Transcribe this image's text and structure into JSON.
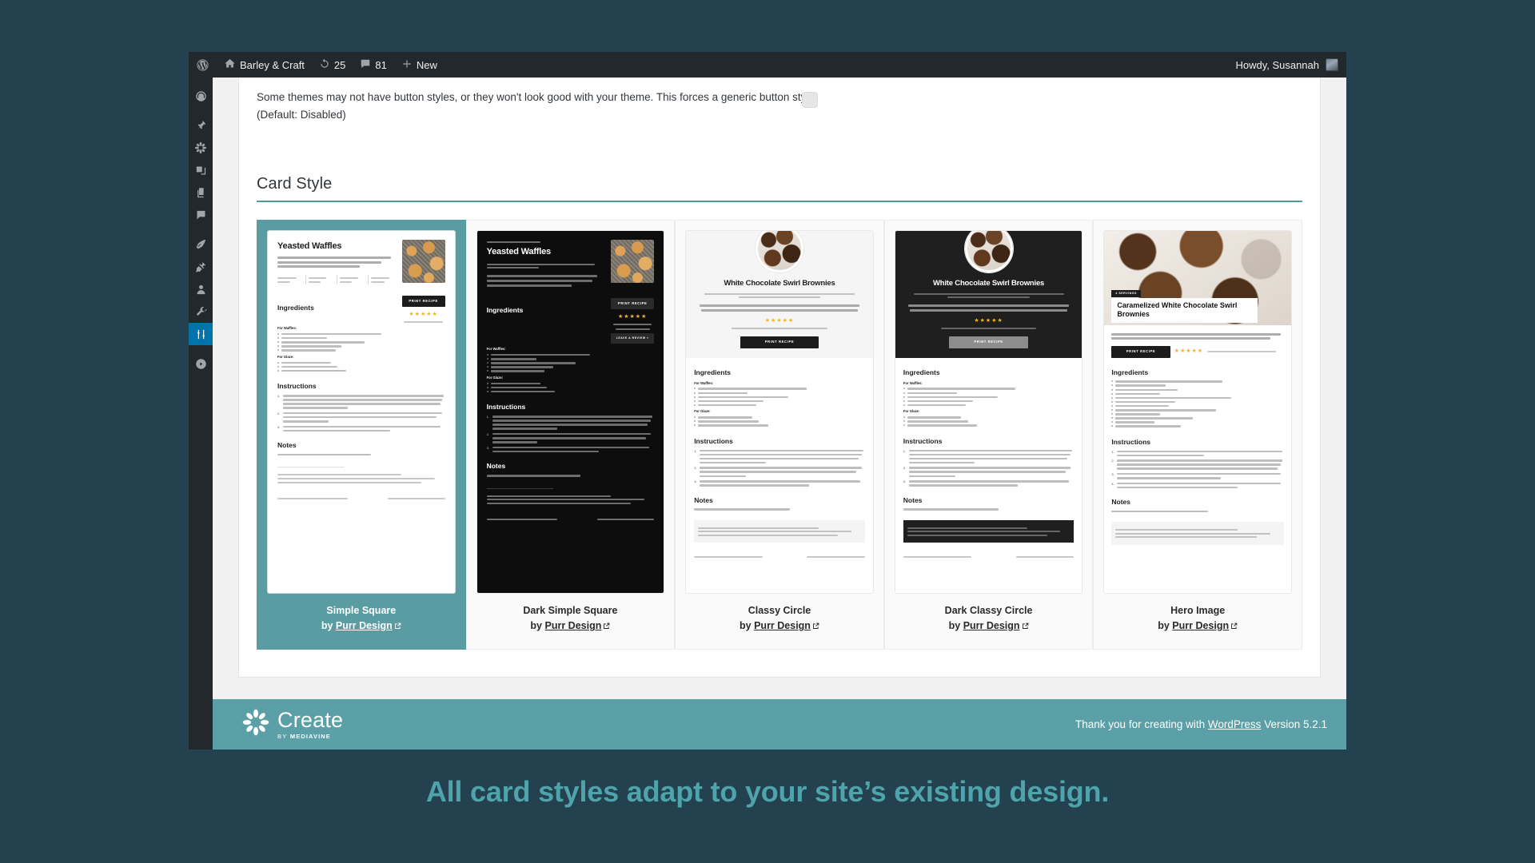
{
  "adminbar": {
    "wp_logo": "wordpress-icon",
    "site_name": "Barley & Craft",
    "updates_count": "25",
    "comments_count": "81",
    "new_label": "New",
    "howdy": "Howdy, Susannah"
  },
  "sidebar": {
    "items": [
      {
        "name": "dashboard",
        "icon": "dashboard-icon",
        "current": false
      },
      {
        "name": "posts",
        "icon": "pin-icon",
        "current": false
      },
      {
        "name": "create",
        "icon": "flower-icon",
        "current": false
      },
      {
        "name": "media",
        "icon": "media-icon",
        "current": false
      },
      {
        "name": "pages",
        "icon": "pages-icon",
        "current": false
      },
      {
        "name": "comments",
        "icon": "comment-icon",
        "current": false
      },
      {
        "name": "appearance",
        "icon": "paintbrush-icon",
        "current": false
      },
      {
        "name": "plugins",
        "icon": "plug-icon",
        "current": false
      },
      {
        "name": "users",
        "icon": "user-icon",
        "current": false
      },
      {
        "name": "tools",
        "icon": "wrench-icon",
        "current": false
      },
      {
        "name": "settings",
        "icon": "sliders-icon",
        "current": true
      },
      {
        "name": "collapse-menu",
        "icon": "collapse-icon",
        "current": false
      }
    ]
  },
  "settings": {
    "note_line1": "Some themes may not have button styles, or they won't look good with your theme. This forces a generic button style.",
    "note_line2": "(Default: Disabled)",
    "checkbox_state": "unchecked"
  },
  "card_style_section": {
    "title": "Card Style",
    "accent_color": "#4f9a9e",
    "selected_color": "#599da3",
    "by_prefix": "by",
    "external_link_icon": "external-link-icon",
    "cards": [
      {
        "name": "Simple Square",
        "author": "Purr Design",
        "selected": true,
        "theme": "light",
        "layout": "simple-square",
        "recipe_title": "Yeasted Waffles",
        "sections": [
          "Ingredients",
          "For Waffles:",
          "For Glaze:",
          "Instructions",
          "Notes"
        ],
        "print_label": "PRINT RECIPE",
        "stars": "★★★★★"
      },
      {
        "name": "Dark Simple Square",
        "author": "Purr Design",
        "selected": false,
        "theme": "dark",
        "layout": "simple-square",
        "recipe_title": "Yeasted Waffles",
        "sections": [
          "Ingredients",
          "For Waffles:",
          "For Glaze:",
          "Instructions",
          "Notes"
        ],
        "print_label": "PRINT RECIPE",
        "stars": "★★★★★"
      },
      {
        "name": "Classy Circle",
        "author": "Purr Design",
        "selected": false,
        "theme": "light",
        "layout": "classy-circle",
        "recipe_title": "White Chocolate Swirl Brownies",
        "sections": [
          "Ingredients",
          "For Waffles:",
          "For Glaze:",
          "Instructions",
          "Notes"
        ],
        "print_label": "PRINT RECIPE",
        "stars": "★★★★★"
      },
      {
        "name": "Dark Classy Circle",
        "author": "Purr Design",
        "selected": false,
        "theme": "dark",
        "layout": "classy-circle",
        "recipe_title": "White Chocolate Swirl Brownies",
        "sections": [
          "Ingredients",
          "For Waffles:",
          "For Glaze:",
          "Instructions",
          "Notes"
        ],
        "print_label": "PRINT RECIPE",
        "stars": "★★★★★"
      },
      {
        "name": "Hero Image",
        "author": "Purr Design",
        "selected": false,
        "theme": "light",
        "layout": "hero-image",
        "recipe_title": "Caramelized White Chocolate Swirl Brownies",
        "hero_badge": "4 SERVINGS",
        "sections": [
          "Ingredients",
          "Instructions",
          "Notes"
        ],
        "print_label": "PRINT RECIPE",
        "stars": "★★★★★"
      }
    ]
  },
  "footer": {
    "brand": "Create",
    "brand_by": "BY",
    "brand_by_strong": "MEDIAVINE",
    "thankyou_prefix": "Thank you for creating with",
    "wordpress_link": "WordPress",
    "version": "Version 5.2.1"
  },
  "caption": "All card styles adapt to your site’s existing design."
}
